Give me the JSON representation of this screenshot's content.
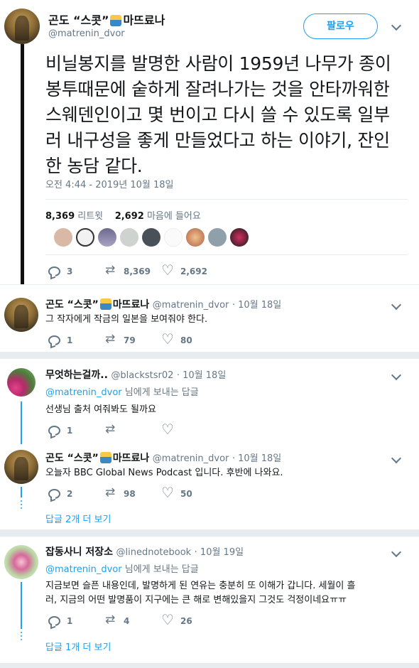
{
  "main": {
    "author_name": "곤도 “스콧”",
    "author_name_suffix": "마뜨료나",
    "author_handle": "@matrenin_dvor",
    "follow_label": "팔로우",
    "text": "비닐봉지를 발명한 사람이 1959년 나무가 종이봉투때문에 숱하게 잘려나가는 것을 안타까워한 스웨덴인이고 몇 번이고 다시 쓸 수 있도록 일부러 내구성을 좋게 만들었다고 하는 이야기, 잔인한 농담 같다.",
    "timestamp": "오전 4:44 - 2019년 10월 18일",
    "retweet_count": "8,369",
    "retweet_label": "리트윗",
    "like_count": "2,692",
    "like_label": "마음에 들어요",
    "actions": {
      "reply": "3",
      "retweet": "8,369",
      "like": "2,692"
    }
  },
  "reply1": {
    "author_name": "곤도 “스콧”",
    "author_name_suffix": "마뜨료나",
    "author_handle": "@matrenin_dvor",
    "time": "· 10월 18일",
    "text": "그 작자에게 작금의 일본을 보여줘야 한다.",
    "actions": {
      "reply": "1",
      "retweet": "79",
      "like": "80"
    }
  },
  "convo1": {
    "tweet_a": {
      "author_name": "무엇하는걸까..",
      "author_handle": "@blackstsr02",
      "time": "· 10월 18일",
      "replying_to": "@matrenin_dvor",
      "replying_suffix": "님에게 보내는 답글",
      "text": "선생님 출처 여줘봐도 될까요",
      "actions": {
        "reply": "1",
        "retweet": "",
        "like": ""
      }
    },
    "tweet_b": {
      "author_name": "곤도 “스콧”",
      "author_name_suffix": "마뜨료나",
      "author_handle": "@matrenin_dvor",
      "time": "· 10월 18일",
      "text": "오늘자 BBC Global News Podcast 입니다. 후반에 나와요.",
      "actions": {
        "reply": "2",
        "retweet": "98",
        "like": "50"
      }
    },
    "more_replies": "답글 2개 더 보기"
  },
  "convo2": {
    "author_name": "잡동사니 저장소",
    "author_handle": "@linednotebook",
    "time": "· 10월 19일",
    "replying_to": "@matrenin_dvor",
    "replying_suffix": "님에게 보내는 답글",
    "text_line1": "지금보면 슬픈 내용인데, 발명하게 된 연유는 충분히 또 이해가 갑니다. 세월이 흘",
    "text_line2": "러, 지금의 어떤 발명품이 지구에는 큰 해로 변해있을지 그것도 걱정이네요ㅠㅠ",
    "actions": {
      "reply": "1",
      "retweet": "4",
      "like": "26"
    },
    "more_replies": "답글 1개 더 보기"
  },
  "colors": {
    "accent": "#1da1f2",
    "muted": "#657786",
    "text": "#14171a",
    "background": "#e6ecf0"
  }
}
